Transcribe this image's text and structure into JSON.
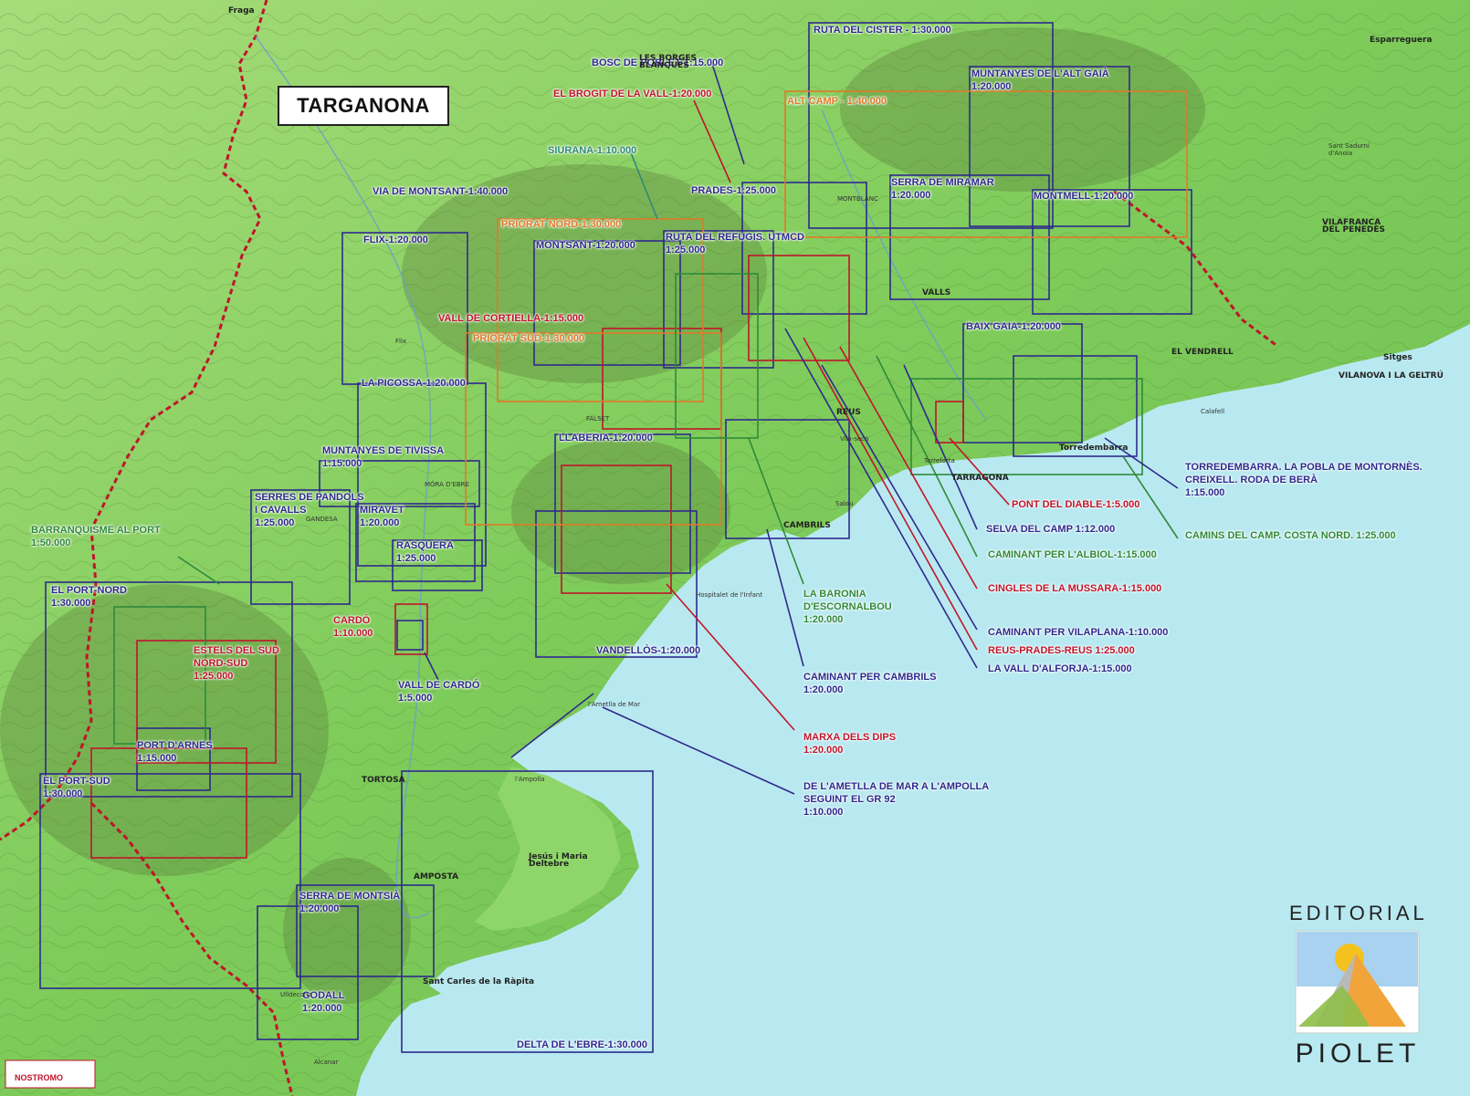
{
  "title": "TARGANONA",
  "publisher": {
    "top": "EDITORIAL",
    "name": "PIOLET"
  },
  "stamp": {
    "name": "NOSTROMO"
  },
  "colors": {
    "land_light": "#8fd66a",
    "land_dark": "#4f9a3c",
    "sea": "#b8e8ef",
    "blue": "#2e2a8c",
    "red": "#c0152a",
    "green": "#2f8a3a",
    "orange": "#e07a28"
  },
  "map_labels": [
    {
      "id": "ruta-cister",
      "text": "RUTA DEL CISTER - 1:30.000",
      "color": "blue"
    },
    {
      "id": "bosc-poblet",
      "text": "BOSC DE POBLET-1:15.000",
      "color": "blue"
    },
    {
      "id": "brogit",
      "text": "EL BROGIT DE LA VALL-1:20.000",
      "color": "red"
    },
    {
      "id": "alt-camp",
      "text": "ALT CAMP - 1:40.000",
      "color": "orange"
    },
    {
      "id": "alt-gaia",
      "text": "MUNTANYES DE L'ALT GAIÀ\n1:20.000",
      "color": "blue"
    },
    {
      "id": "siurana",
      "text": "SIURANA-1:10.000",
      "color": "teal"
    },
    {
      "id": "via-montsant",
      "text": "VIA DE MONTSANT-1:40.000",
      "color": "blue"
    },
    {
      "id": "prades",
      "text": "PRADES-1:25.000",
      "color": "blue"
    },
    {
      "id": "miramar",
      "text": "SERRA DE MIRAMAR\n1:20.000",
      "color": "blue"
    },
    {
      "id": "montmell",
      "text": "MONTMELL-1:20.000",
      "color": "blue"
    },
    {
      "id": "priorat-nord",
      "text": "PRIORAT NORD-1:30.000",
      "color": "orange"
    },
    {
      "id": "flix",
      "text": "FLIX-1:20.000",
      "color": "blue"
    },
    {
      "id": "montsant",
      "text": "MONTSANT-1:20.000",
      "color": "blue"
    },
    {
      "id": "ruta-refugis",
      "text": "RUTA DEL REFUGIS. UTMCD\n1:25.000",
      "color": "blue"
    },
    {
      "id": "cortiella",
      "text": "VALL DE CORTIELLA-1:15.000",
      "color": "red"
    },
    {
      "id": "priorat-sud",
      "text": "PRIORAT SUD-1:30.000",
      "color": "orange"
    },
    {
      "id": "baix-gaia",
      "text": "BAIX GAIA-1:20.000",
      "color": "blue"
    },
    {
      "id": "picossa",
      "text": "LA PICOSSA-1:20.000",
      "color": "blue"
    },
    {
      "id": "llaberia",
      "text": "LLABERIA-1:20.000",
      "color": "blue"
    },
    {
      "id": "tivissa",
      "text": "MUNTANYES DE TIVISSA\n1:15.000",
      "color": "blue"
    },
    {
      "id": "pandols",
      "text": "SERRES DE PANDOLS\nI CAVALLS\n1:25.000",
      "color": "blue"
    },
    {
      "id": "miravet",
      "text": "MIRAVET\n1:20.000",
      "color": "blue"
    },
    {
      "id": "rasquera",
      "text": "RASQUERA\n1:25.000",
      "color": "blue"
    },
    {
      "id": "barranquisme",
      "text": "BARRANQUISME AL PORT\n1:50.000",
      "color": "green"
    },
    {
      "id": "port-nord",
      "text": "EL PORT-NORD\n1:30.000",
      "color": "blue"
    },
    {
      "id": "cardo",
      "text": "CARDÓ\n1:10.000",
      "color": "red"
    },
    {
      "id": "estels",
      "text": "ESTELS DEL SUD\nNORD-SUD\n1:25.000",
      "color": "red"
    },
    {
      "id": "vall-cardo",
      "text": "VALL DE CARDÓ\n1:5.000",
      "color": "blue"
    },
    {
      "id": "port-arnes",
      "text": "PORT D'ARNES\n1:15.000",
      "color": "blue"
    },
    {
      "id": "port-sud",
      "text": "EL PORT-SUD\n1:30.000",
      "color": "blue"
    },
    {
      "id": "vandellos",
      "text": "VANDELLÒS-1:20.000",
      "color": "blue"
    },
    {
      "id": "montsia",
      "text": "SERRA DE MONTSIÀ\n1:20.000",
      "color": "blue"
    },
    {
      "id": "godall",
      "text": "GODALL\n1:20.000",
      "color": "blue"
    },
    {
      "id": "delta",
      "text": "DELTA DE L'EBRE-1:30.000",
      "color": "blue"
    },
    {
      "id": "torredembarra-lbl",
      "text": "TORREDEMBARRA. LA POBLA DE MONTORNÈS.\nCREIXELL. RODA DE BERÀ\n1:15.000",
      "color": "blue"
    },
    {
      "id": "pont-diable",
      "text": "PONT DEL DIABLE-1:5.000",
      "color": "red"
    },
    {
      "id": "selva-camp",
      "text": "SELVA DEL CAMP 1:12.000",
      "color": "blue"
    },
    {
      "id": "camins-camp",
      "text": "CAMINS DEL CAMP. COSTA NORD. 1:25.000",
      "color": "green"
    },
    {
      "id": "albiol",
      "text": "CAMINANT PER L'ALBIOL-1:15.000",
      "color": "green"
    },
    {
      "id": "mussara",
      "text": "CINGLES DE LA MUSSARA-1:15.000",
      "color": "red"
    },
    {
      "id": "escornalbou",
      "text": "LA BARONIA\nD'ESCORNALBOU\n1:20.000",
      "color": "green"
    },
    {
      "id": "vilaplana",
      "text": "CAMINANT PER VILAPLANA-1:10.000",
      "color": "blue"
    },
    {
      "id": "reus-prades",
      "text": "REUS-PRADES-REUS 1:25.000",
      "color": "red"
    },
    {
      "id": "alforja",
      "text": "LA VALL D'ALFORJA-1:15.000",
      "color": "blue"
    },
    {
      "id": "cambrils-lbl",
      "text": "CAMINANT PER CAMBRILS\n1:20.000",
      "color": "blue"
    },
    {
      "id": "dips",
      "text": "MARXA DELS DIPS\n1:20.000",
      "color": "red"
    },
    {
      "id": "ametlla",
      "text": "DE L'AMETLLA DE MAR A L'AMPOLLA\nSEGUINT EL GR 92\n1:10.000",
      "color": "blue"
    }
  ],
  "towns": [
    {
      "id": "fraga",
      "text": "Fraga"
    },
    {
      "id": "tortosa",
      "text": "TORTOSA"
    },
    {
      "id": "amposta",
      "text": "AMPOSTA"
    },
    {
      "id": "reus",
      "text": "REUS"
    },
    {
      "id": "tarragona-town",
      "text": "TARRAGONA"
    },
    {
      "id": "valls",
      "text": "VALLS"
    },
    {
      "id": "cambrils",
      "text": "CAMBRILS"
    },
    {
      "id": "vilafranca",
      "text": "VILAFRANCA\nDEL PENEDÈS"
    },
    {
      "id": "vendrell",
      "text": "EL VENDRELL"
    },
    {
      "id": "vilanova",
      "text": "VILANOVA I LA GELTRÚ"
    },
    {
      "id": "sitges",
      "text": "Sitges"
    },
    {
      "id": "esparreguera",
      "text": "Esparreguera"
    },
    {
      "id": "borges",
      "text": "LES BORGES\nBLANQUES"
    },
    {
      "id": "deltebre",
      "text": "Jesús i Maria\nDeltebre"
    },
    {
      "id": "rapita",
      "text": "Sant Carles de la Ràpita"
    },
    {
      "id": "falset",
      "text": "FALSET"
    },
    {
      "id": "gandesa",
      "text": "GANDESA"
    },
    {
      "id": "mora",
      "text": "MÓRA D'EBRE"
    },
    {
      "id": "salou",
      "text": "Salou"
    },
    {
      "id": "vila-seca",
      "text": "Vila-seca"
    },
    {
      "id": "torredembarra",
      "text": "Torredembarra"
    },
    {
      "id": "ametlla-town",
      "text": "l'Ametlla de Mar"
    },
    {
      "id": "ampolla-town",
      "text": "l'Ampolla"
    },
    {
      "id": "hospitalet",
      "text": "Hospitalet de l'Infant"
    },
    {
      "id": "alcanar",
      "text": "Alcanar"
    },
    {
      "id": "ulldecona",
      "text": "Ulldecona"
    },
    {
      "id": "flix-town",
      "text": "Flix"
    },
    {
      "id": "calafell",
      "text": "Calafell"
    },
    {
      "id": "torrefeta",
      "text": "Torreforta"
    },
    {
      "id": "sant-sadurni",
      "text": "Sant Sadurní\nd'Anoia"
    },
    {
      "id": "montblanc",
      "text": "MONTBLANC"
    }
  ]
}
